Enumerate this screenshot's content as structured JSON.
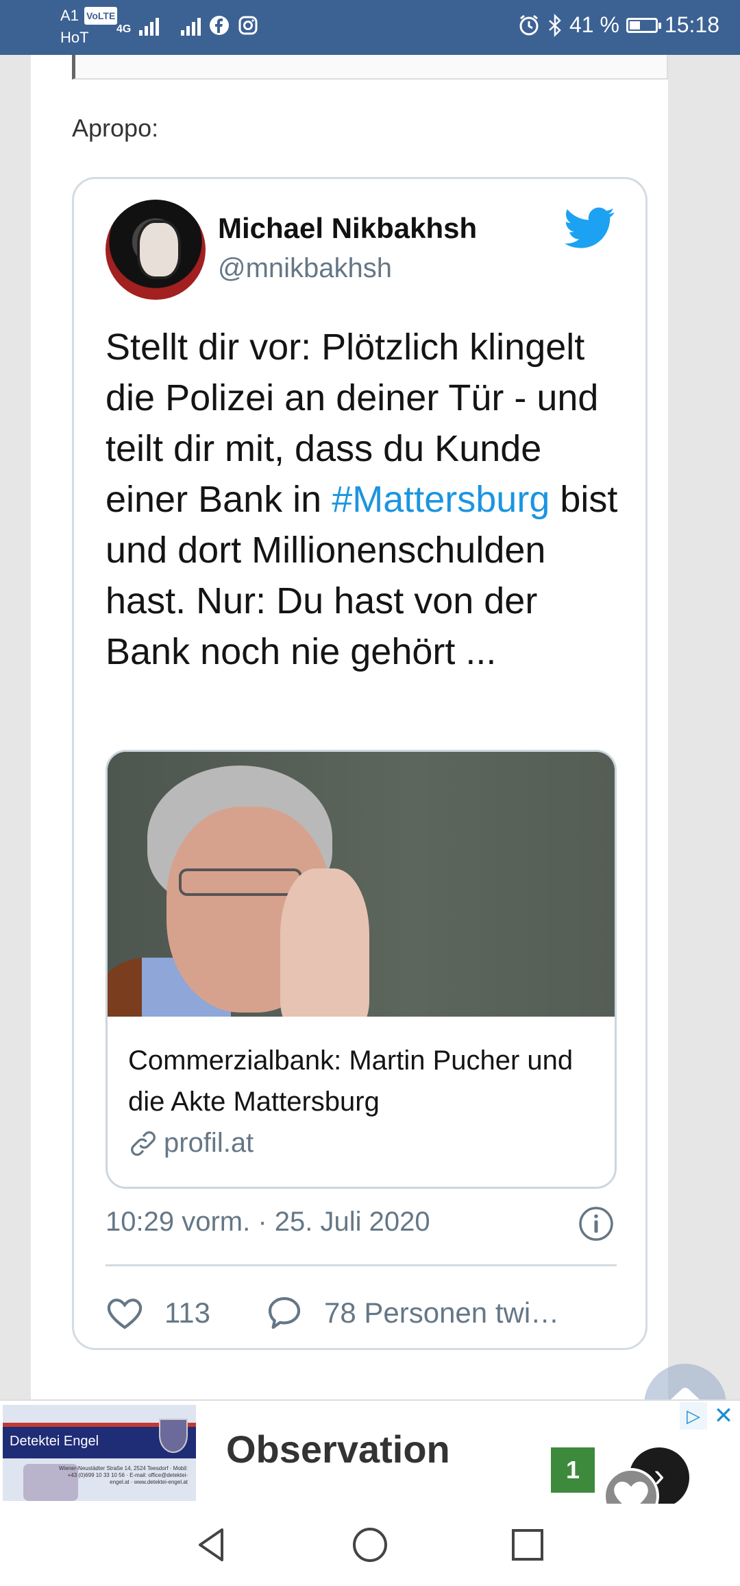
{
  "status_bar": {
    "carrier_line1": "A1",
    "volte": "VoLTE",
    "carrier_line2": "HoT",
    "network": "4G",
    "battery_percent_label": "41 %",
    "battery_level": 0.41,
    "time": "15:18"
  },
  "article": {
    "apropo_label": "Apropo:"
  },
  "tweet": {
    "author_name": "Michael Nikbakhsh",
    "author_handle": "@mnikbakhsh",
    "text_part1": "Stellt dir vor: Plötzlich klingelt die Polizei an deiner Tür - und teilt dir mit, dass du Kunde einer Bank in ",
    "hashtag": "#Mattersburg",
    "text_part2": " bist und dort Millionenschulden hast. Nur: Du hast von der Bank noch nie gehört ...",
    "link_card": {
      "title": "Commerzialbank: Martin Pucher und die Akte Mattersburg",
      "domain": "profil.at"
    },
    "timestamp": "10:29 vorm. · 25. Juli 2020",
    "likes": "113",
    "replies_label": "78 Personen twi…"
  },
  "ad": {
    "image_brand": "Detektei Engel",
    "image_address": "Wiener-Neustädter Straße 14, 2524 Teesdorf · Mobil: +43 (0)699 10 33 10 56 · E-mail: office@detektei-engel.at · www.detektei-engel.at",
    "title": "Observation",
    "badge": "1",
    "close_label": "✕",
    "choices_label": "▷",
    "next_label": "›"
  },
  "colors": {
    "status_bar": "#3c6193",
    "twitter_blue": "#1da1f2",
    "hashtag": "#1b95e0",
    "muted": "#657786"
  },
  "icons": [
    "alarm-icon",
    "bluetooth-icon",
    "facebook-icon",
    "instagram-icon",
    "twitter-bird-icon",
    "heart-icon",
    "comment-icon",
    "info-icon",
    "link-icon",
    "chevron-up-icon",
    "back-icon",
    "home-icon",
    "recents-icon"
  ]
}
